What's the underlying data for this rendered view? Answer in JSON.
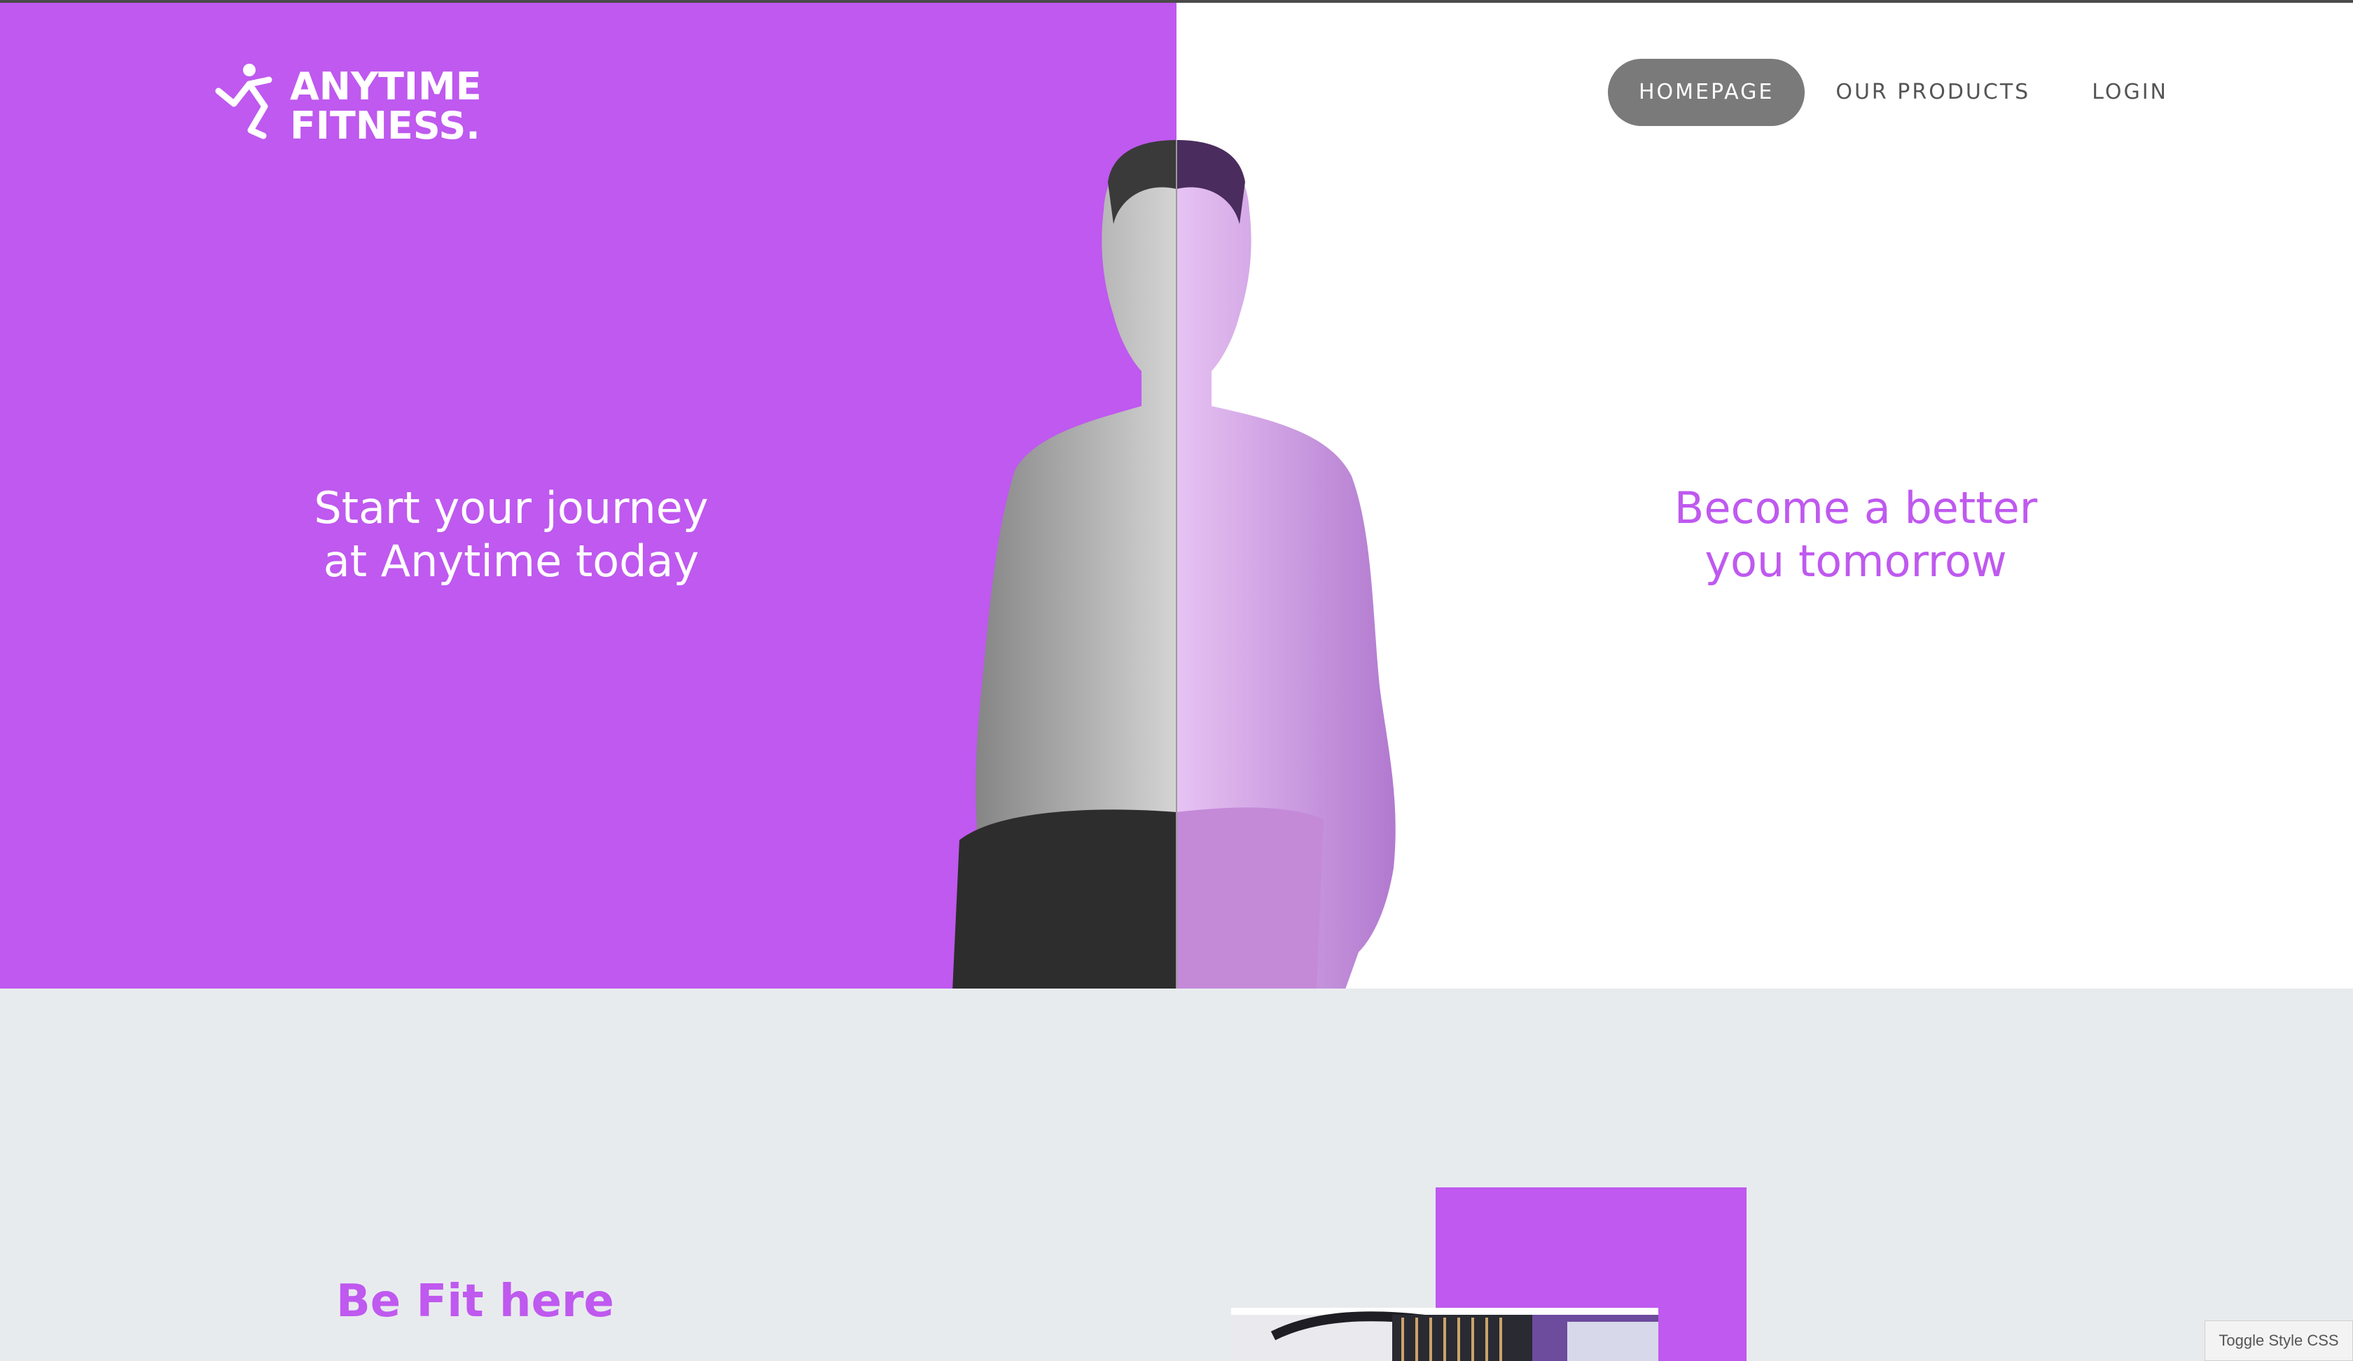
{
  "brand": {
    "logo_line1": "ANYTIME",
    "logo_line2": "FITNESS.",
    "icon": "running-man-logo-icon"
  },
  "nav": {
    "items": [
      {
        "label": "HOMEPAGE",
        "active": true
      },
      {
        "label": "OUR PRODUCTS",
        "active": false
      },
      {
        "label": "LOGIN",
        "active": false
      }
    ]
  },
  "hero": {
    "left_line1": "Start your journey",
    "left_line2": "at Anytime today",
    "right_line1": "Become a better",
    "right_line2": "you tomorrow"
  },
  "section": {
    "title": "Be Fit here"
  },
  "toggle": {
    "label": "Toggle Style CSS"
  },
  "colors": {
    "brand_purple": "#bf59ef",
    "nav_active_bg": "#7a7a7a",
    "section_bg": "#e8ebee"
  }
}
